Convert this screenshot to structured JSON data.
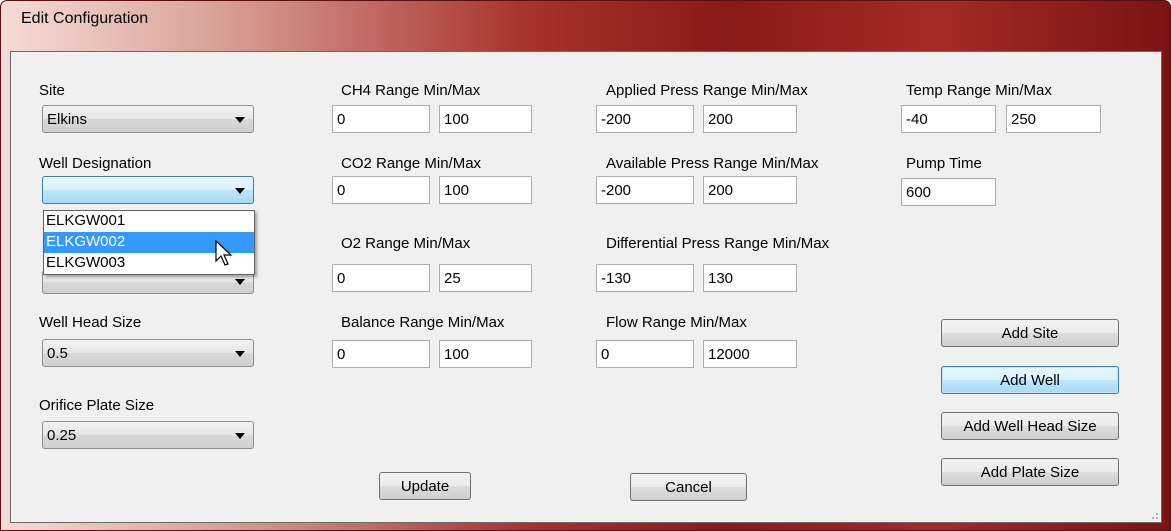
{
  "window": {
    "title": "Edit Configuration"
  },
  "site": {
    "label": "Site",
    "value": "Elkins"
  },
  "well_designation": {
    "label": "Well Designation",
    "value": "",
    "options": [
      "ELKGW001",
      "ELKGW002",
      "ELKGW003"
    ],
    "highlighted": "ELKGW002"
  },
  "well_head_size": {
    "label": "Well Head Size",
    "value": "0.5"
  },
  "orifice_plate_size": {
    "label": "Orifice Plate Size",
    "value": "0.25"
  },
  "ch4": {
    "label": "CH4 Range Min/Max",
    "min": "0",
    "max": "100"
  },
  "co2": {
    "label": "CO2 Range Min/Max",
    "min": "0",
    "max": "100"
  },
  "o2": {
    "label": "O2 Range Min/Max",
    "min": "0",
    "max": "25"
  },
  "balance": {
    "label": "Balance Range Min/Max",
    "min": "0",
    "max": "100"
  },
  "applied_press": {
    "label": "Applied Press Range Min/Max",
    "min": "-200",
    "max": "200"
  },
  "available_press": {
    "label": "Available Press Range Min/Max",
    "min": "-200",
    "max": "200"
  },
  "differential_press": {
    "label": "Differential Press Range Min/Max",
    "min": "-130",
    "max": "130"
  },
  "flow": {
    "label": "Flow Range Min/Max",
    "min": "0",
    "max": "12000"
  },
  "temp": {
    "label": "Temp Range Min/Max",
    "min": "-40",
    "max": "250"
  },
  "pump_time": {
    "label": "Pump Time",
    "value": "600"
  },
  "buttons": {
    "add_site": "Add Site",
    "add_well": "Add Well",
    "add_well_head_size": "Add Well Head Size",
    "add_plate_size": "Add Plate Size",
    "update": "Update",
    "cancel": "Cancel"
  },
  "colors": {
    "title_bar_accent": "#8a1a17",
    "selection": "#3399ff"
  }
}
